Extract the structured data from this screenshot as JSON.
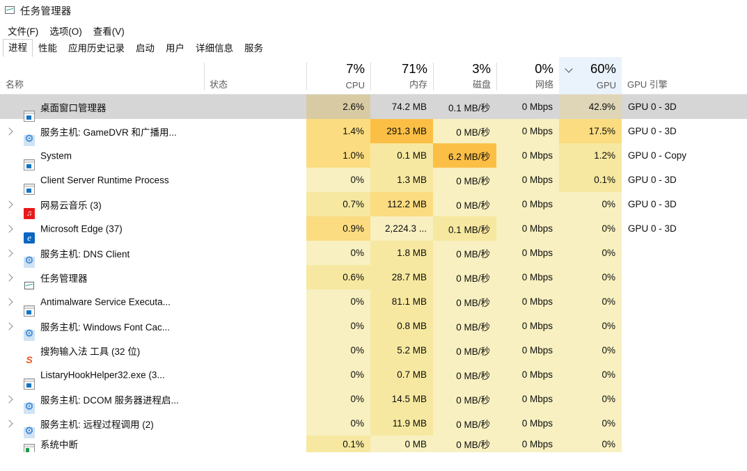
{
  "window": {
    "title": "任务管理器",
    "icon": "task-manager-icon"
  },
  "menu": [
    {
      "label": "文件(F)"
    },
    {
      "label": "选项(O)"
    },
    {
      "label": "查看(V)"
    }
  ],
  "tabs": [
    {
      "label": "进程",
      "active": true
    },
    {
      "label": "性能",
      "active": false
    },
    {
      "label": "应用历史记录",
      "active": false
    },
    {
      "label": "启动",
      "active": false
    },
    {
      "label": "用户",
      "active": false
    },
    {
      "label": "详细信息",
      "active": false
    },
    {
      "label": "服务",
      "active": false
    }
  ],
  "columns": [
    {
      "key": "name",
      "label": "名称",
      "summary": "",
      "align": "left",
      "sorted": false
    },
    {
      "key": "status",
      "label": "状态",
      "summary": "",
      "align": "left",
      "sorted": false
    },
    {
      "key": "cpu",
      "label": "CPU",
      "summary": "7%",
      "align": "right",
      "sorted": false
    },
    {
      "key": "memory",
      "label": "内存",
      "summary": "71%",
      "align": "right",
      "sorted": false
    },
    {
      "key": "disk",
      "label": "磁盘",
      "summary": "3%",
      "align": "right",
      "sorted": false
    },
    {
      "key": "network",
      "label": "网络",
      "summary": "0%",
      "align": "right",
      "sorted": false
    },
    {
      "key": "gpu",
      "label": "GPU",
      "summary": "60%",
      "align": "right",
      "sorted": true,
      "sort_direction": "descending"
    },
    {
      "key": "engine",
      "label": "GPU 引擎",
      "summary": "",
      "align": "left",
      "sorted": false
    }
  ],
  "rows": [
    {
      "name": "桌面窗口管理器",
      "icon": "window-icon",
      "expandable": false,
      "selected": true,
      "status": "",
      "cpu": "2.6%",
      "memory": "74.2 MB",
      "disk": "0.1 MB/秒",
      "network": "0 Mbps",
      "gpu": "42.9%",
      "engine": "GPU 0 - 3D"
    },
    {
      "name": "服务主机: GameDVR 和广播用...",
      "icon": "gear-icon",
      "expandable": true,
      "selected": false,
      "status": "",
      "cpu": "1.4%",
      "memory": "291.3 MB",
      "disk": "0 MB/秒",
      "network": "0 Mbps",
      "gpu": "17.5%",
      "engine": "GPU 0 - 3D"
    },
    {
      "name": "System",
      "icon": "window-icon",
      "expandable": false,
      "selected": false,
      "status": "",
      "cpu": "1.0%",
      "memory": "0.1 MB",
      "disk": "6.2 MB/秒",
      "network": "0 Mbps",
      "gpu": "1.2%",
      "engine": "GPU 0 - Copy"
    },
    {
      "name": "Client Server Runtime Process",
      "icon": "window-icon",
      "expandable": false,
      "selected": false,
      "status": "",
      "cpu": "0%",
      "memory": "1.3 MB",
      "disk": "0 MB/秒",
      "network": "0 Mbps",
      "gpu": "0.1%",
      "engine": "GPU 0 - 3D"
    },
    {
      "name": "网易云音乐 (3)",
      "icon": "netease-music-icon",
      "expandable": true,
      "selected": false,
      "status": "",
      "cpu": "0.7%",
      "memory": "112.2 MB",
      "disk": "0 MB/秒",
      "network": "0 Mbps",
      "gpu": "0%",
      "engine": "GPU 0 - 3D"
    },
    {
      "name": "Microsoft Edge (37)",
      "icon": "edge-icon",
      "expandable": true,
      "selected": false,
      "status": "",
      "cpu": "0.9%",
      "memory": "2,224.3 ...",
      "disk": "0.1 MB/秒",
      "network": "0 Mbps",
      "gpu": "0%",
      "engine": "GPU 0 - 3D"
    },
    {
      "name": "服务主机: DNS Client",
      "icon": "gear-icon",
      "expandable": true,
      "selected": false,
      "status": "",
      "cpu": "0%",
      "memory": "1.8 MB",
      "disk": "0 MB/秒",
      "network": "0 Mbps",
      "gpu": "0%",
      "engine": ""
    },
    {
      "name": "任务管理器",
      "icon": "task-manager-icon",
      "expandable": true,
      "selected": false,
      "status": "",
      "cpu": "0.6%",
      "memory": "28.7 MB",
      "disk": "0 MB/秒",
      "network": "0 Mbps",
      "gpu": "0%",
      "engine": ""
    },
    {
      "name": "Antimalware Service Executa...",
      "icon": "window-icon",
      "expandable": true,
      "selected": false,
      "status": "",
      "cpu": "0%",
      "memory": "81.1 MB",
      "disk": "0 MB/秒",
      "network": "0 Mbps",
      "gpu": "0%",
      "engine": ""
    },
    {
      "name": "服务主机: Windows Font Cac...",
      "icon": "gear-icon",
      "expandable": true,
      "selected": false,
      "status": "",
      "cpu": "0%",
      "memory": "0.8 MB",
      "disk": "0 MB/秒",
      "network": "0 Mbps",
      "gpu": "0%",
      "engine": ""
    },
    {
      "name": "搜狗输入法 工具 (32 位)",
      "icon": "sogou-icon",
      "expandable": false,
      "selected": false,
      "status": "",
      "cpu": "0%",
      "memory": "5.2 MB",
      "disk": "0 MB/秒",
      "network": "0 Mbps",
      "gpu": "0%",
      "engine": ""
    },
    {
      "name": "ListaryHookHelper32.exe (3...",
      "icon": "window-icon",
      "expandable": false,
      "selected": false,
      "status": "",
      "cpu": "0%",
      "memory": "0.7 MB",
      "disk": "0 MB/秒",
      "network": "0 Mbps",
      "gpu": "0%",
      "engine": ""
    },
    {
      "name": "服务主机: DCOM 服务器进程启...",
      "icon": "gear-icon",
      "expandable": true,
      "selected": false,
      "status": "",
      "cpu": "0%",
      "memory": "14.5 MB",
      "disk": "0 MB/秒",
      "network": "0 Mbps",
      "gpu": "0%",
      "engine": ""
    },
    {
      "name": "服务主机: 远程过程调用 (2)",
      "icon": "gear-icon",
      "expandable": true,
      "selected": false,
      "status": "",
      "cpu": "0%",
      "memory": "11.9 MB",
      "disk": "0 MB/秒",
      "network": "0 Mbps",
      "gpu": "0%",
      "engine": ""
    },
    {
      "name": "系统中断",
      "icon": "system-interrupts-icon",
      "expandable": false,
      "selected": false,
      "partial": true,
      "status": "",
      "cpu": "0.1%",
      "memory": "0 MB",
      "disk": "0 MB/秒",
      "network": "0 Mbps",
      "gpu": "0%",
      "engine": ""
    }
  ],
  "colors": {
    "selected_row": "#d6d6d6",
    "heat_light": "#f8f0c0",
    "heat_mid": "#f6e8a0",
    "heat_strong": "#fbdc80",
    "heat_hot": "#fcbf45",
    "sorted_header": "#eaf3fb",
    "accent": "#0c66c2"
  }
}
